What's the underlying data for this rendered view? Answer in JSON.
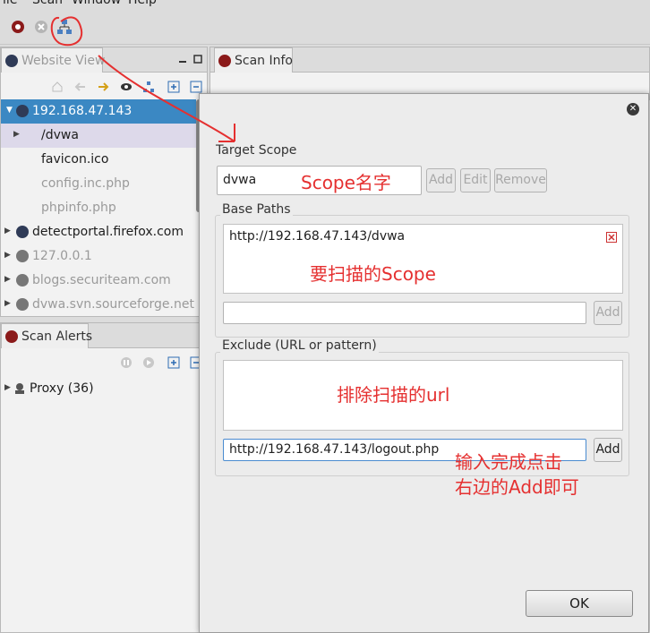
{
  "menubar": {
    "items": [
      "File",
      "Scan",
      "Window",
      "Help"
    ]
  },
  "toolbar": {
    "icons": [
      "scan-start-icon",
      "stop-icon",
      "scope-tree-icon"
    ]
  },
  "website_view": {
    "tab_label": "Website View",
    "tree": [
      {
        "label": "192.168.47.143",
        "state": "selected",
        "expanded": true
      },
      {
        "label": "/dvwa",
        "state": "child-highlight"
      },
      {
        "label": "favicon.ico",
        "state": "child"
      },
      {
        "label": "config.inc.php",
        "state": "child-muted"
      },
      {
        "label": "phpinfo.php",
        "state": "child-muted"
      },
      {
        "label": "detectportal.firefox.com",
        "state": "root"
      },
      {
        "label": "127.0.0.1",
        "state": "root-muted"
      },
      {
        "label": "blogs.securiteam.com",
        "state": "root-muted"
      },
      {
        "label": "dvwa.svn.sourceforge.net",
        "state": "root-muted"
      }
    ]
  },
  "scan_info": {
    "tab_label": "Scan Info"
  },
  "scan_alerts": {
    "tab_label": "Scan Alerts",
    "items": [
      {
        "label": "Proxy (36)"
      }
    ]
  },
  "dialog": {
    "target_scope_label": "Target Scope",
    "scope_value": "dvwa",
    "add_label": "Add",
    "edit_label": "Edit",
    "remove_label": "Remove",
    "base_paths_label": "Base Paths",
    "base_paths": [
      "http://192.168.47.143/dvwa"
    ],
    "base_path_input": "",
    "base_add_label": "Add",
    "exclude_label": "Exclude (URL or pattern)",
    "exclude_input": "http://192.168.47.143/logout.php",
    "exclude_add_label": "Add",
    "ok_label": "OK"
  },
  "annotations": {
    "scope_name": "Scope名字",
    "scope_to_scan": "要扫描的Scope",
    "exclude_url": "排除扫描的url",
    "hint_line1": "输入完成点击",
    "hint_line2": "右边的Add即可"
  },
  "colors": {
    "selection": "#3b88c3",
    "annotation": "#e53030"
  }
}
